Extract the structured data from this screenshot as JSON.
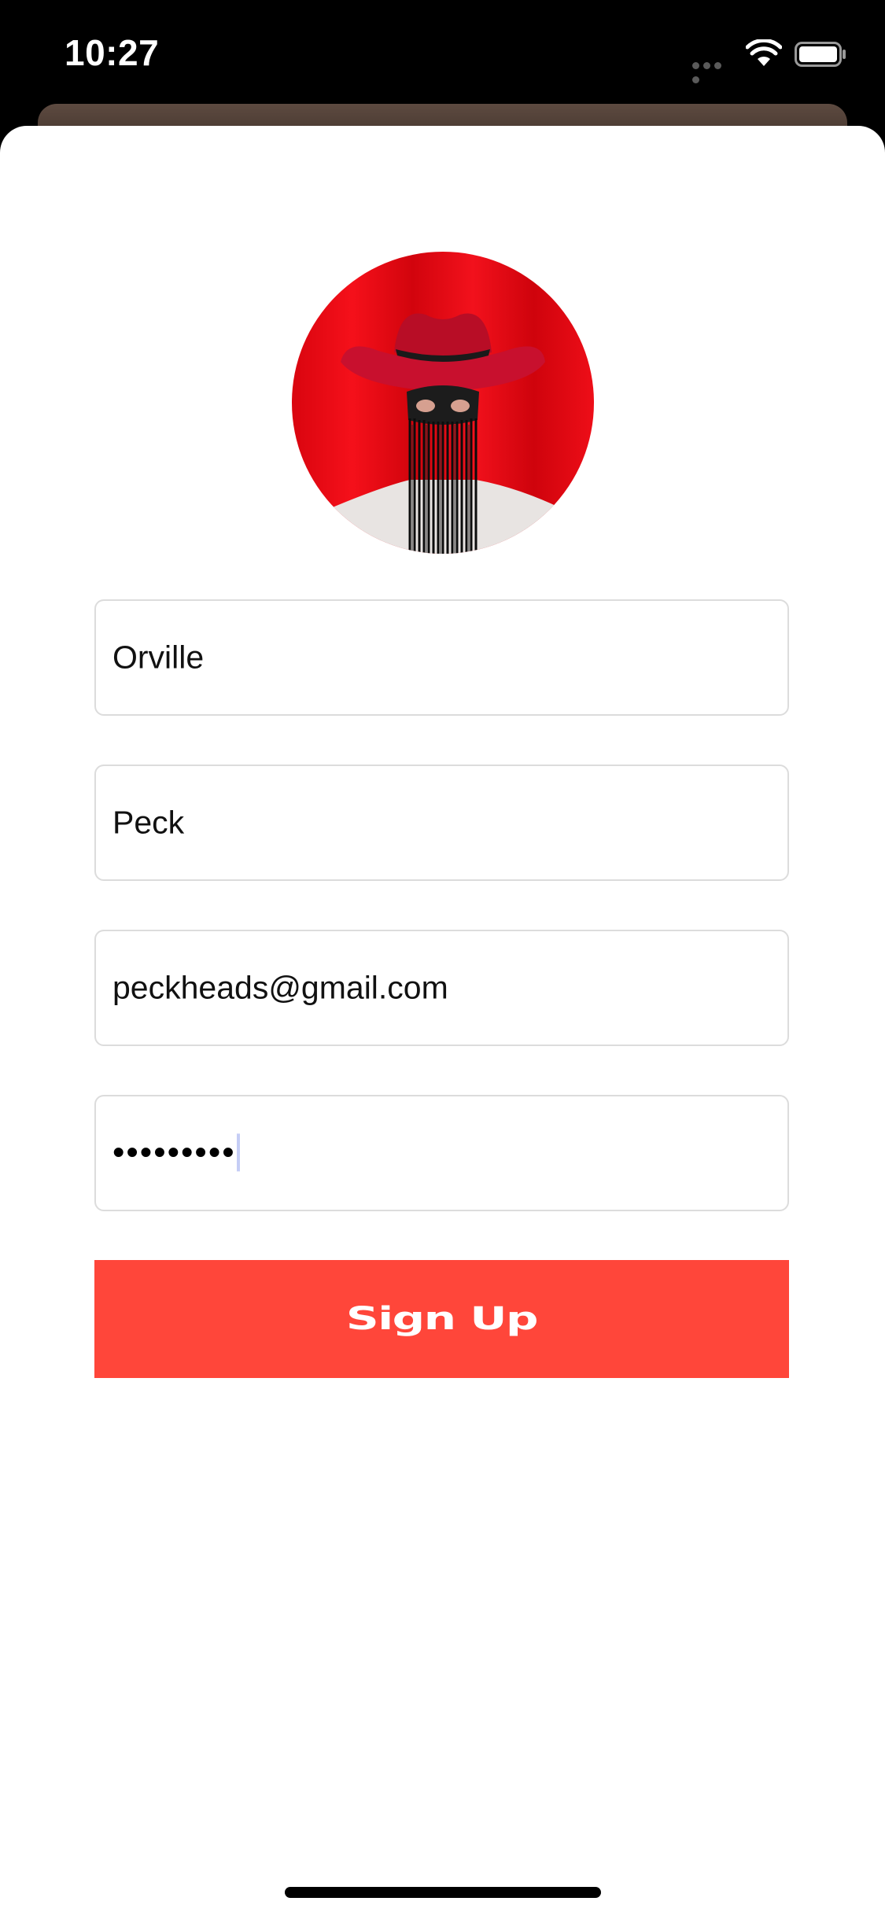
{
  "status_bar": {
    "time": "10:27"
  },
  "icons": {
    "wifi": "wifi-icon",
    "battery": "battery-icon",
    "cellular": "cellular-signal-icon"
  },
  "colors": {
    "accent": "#ff463a",
    "avatar_background": "#e30613",
    "field_border": "#dcdcdc"
  },
  "form": {
    "first_name": "Orville",
    "last_name": "Peck",
    "email": "peckheads@gmail.com",
    "password_masked": "•••••••••",
    "submit_label": "Sign Up"
  }
}
